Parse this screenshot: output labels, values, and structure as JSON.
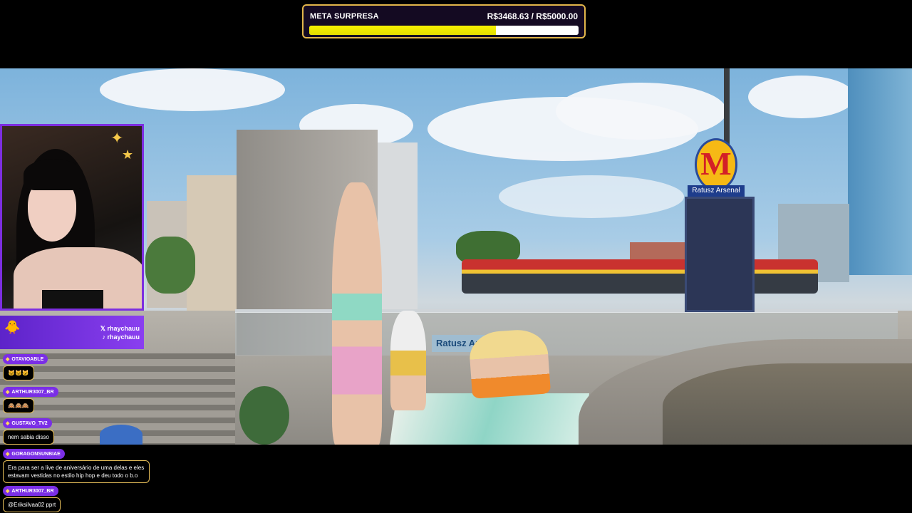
{
  "goal": {
    "title": "META SURPRESA",
    "amount": "R$3468.63 / R$5000.00",
    "progress": 0.6937
  },
  "scene": {
    "metro_letter": "M",
    "metro_station": "Ratusz Arsenał",
    "subway_wall_text": "Ratusz Arsenał"
  },
  "socials": {
    "icon": "duck-icon",
    "items": [
      {
        "icon": "x-icon",
        "handle": "𝕏 rhaychauu"
      },
      {
        "icon": "tiktok-icon",
        "handle": "♪ rhaychauu"
      }
    ]
  },
  "chat": [
    {
      "user": "OTAVIOABLE",
      "message": "🐱🐱🐱"
    },
    {
      "user": "ARTHUR3007_BR",
      "message": "🙈🙈🙈"
    },
    {
      "user": "GUSTAVO_TV2",
      "message": "nem sabia disso"
    },
    {
      "user": "GORAGONSUNBIAE",
      "message": "Era para ser a live de aniversário de uma delas e eles estavam vestidas no estilo hip hop e deu todo o b.o"
    },
    {
      "user": "ARTHUR3007_BR",
      "message": "@Eriksilvaa02 pprt"
    }
  ],
  "colors": {
    "accent": "#7d2ee0",
    "goal_border": "#e2b64a",
    "goal_fill": "#e9e300"
  }
}
